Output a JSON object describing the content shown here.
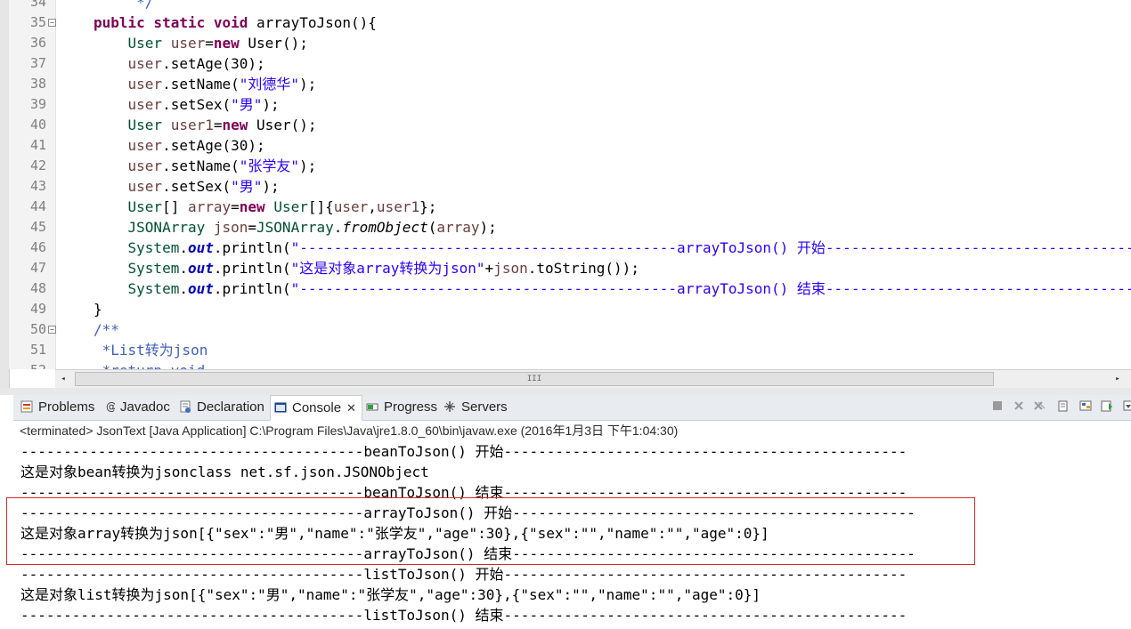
{
  "editor": {
    "lines": [
      {
        "n": "34",
        "fold": false,
        "code": [
          {
            "c": "cmt",
            "t": "     */"
          }
        ]
      },
      {
        "n": "35",
        "fold": true,
        "code": [
          {
            "c": "kw",
            "t": "public static void "
          },
          {
            "c": "",
            "t": "arrayToJson(){"
          }
        ]
      },
      {
        "n": "36",
        "fold": false,
        "code": [
          {
            "c": "",
            "t": "    "
          },
          {
            "c": "ty",
            "t": "User "
          },
          {
            "c": "var",
            "t": "user"
          },
          {
            "c": "",
            "t": "="
          },
          {
            "c": "kw",
            "t": "new "
          },
          {
            "c": "",
            "t": "User();"
          }
        ]
      },
      {
        "n": "37",
        "fold": false,
        "code": [
          {
            "c": "",
            "t": "    "
          },
          {
            "c": "var",
            "t": "user"
          },
          {
            "c": "",
            "t": ".setAge(30);"
          }
        ]
      },
      {
        "n": "38",
        "fold": false,
        "code": [
          {
            "c": "",
            "t": "    "
          },
          {
            "c": "var",
            "t": "user"
          },
          {
            "c": "",
            "t": ".setName("
          },
          {
            "c": "str",
            "t": "\"刘德华\""
          },
          {
            "c": "",
            "t": ");"
          }
        ]
      },
      {
        "n": "39",
        "fold": false,
        "code": [
          {
            "c": "",
            "t": "    "
          },
          {
            "c": "var",
            "t": "user"
          },
          {
            "c": "",
            "t": ".setSex("
          },
          {
            "c": "str",
            "t": "\"男\""
          },
          {
            "c": "",
            "t": ");"
          }
        ]
      },
      {
        "n": "40",
        "fold": false,
        "code": [
          {
            "c": "",
            "t": "    "
          },
          {
            "c": "ty",
            "t": "User "
          },
          {
            "c": "var",
            "t": "user1"
          },
          {
            "c": "",
            "t": "="
          },
          {
            "c": "kw",
            "t": "new "
          },
          {
            "c": "",
            "t": "User();"
          }
        ]
      },
      {
        "n": "41",
        "fold": false,
        "code": [
          {
            "c": "",
            "t": "    "
          },
          {
            "c": "var",
            "t": "user"
          },
          {
            "c": "",
            "t": ".setAge(30);"
          }
        ]
      },
      {
        "n": "42",
        "fold": false,
        "code": [
          {
            "c": "",
            "t": "    "
          },
          {
            "c": "var",
            "t": "user"
          },
          {
            "c": "",
            "t": ".setName("
          },
          {
            "c": "str",
            "t": "\"张学友\""
          },
          {
            "c": "",
            "t": ");"
          }
        ]
      },
      {
        "n": "43",
        "fold": false,
        "code": [
          {
            "c": "",
            "t": "    "
          },
          {
            "c": "var",
            "t": "user"
          },
          {
            "c": "",
            "t": ".setSex("
          },
          {
            "c": "str",
            "t": "\"男\""
          },
          {
            "c": "",
            "t": ");"
          }
        ]
      },
      {
        "n": "44",
        "fold": false,
        "code": [
          {
            "c": "",
            "t": "    "
          },
          {
            "c": "ty",
            "t": "User"
          },
          {
            "c": "",
            "t": "[] "
          },
          {
            "c": "var",
            "t": "array"
          },
          {
            "c": "",
            "t": "="
          },
          {
            "c": "kw",
            "t": "new "
          },
          {
            "c": "ty",
            "t": "User"
          },
          {
            "c": "",
            "t": "[]{"
          },
          {
            "c": "var",
            "t": "user"
          },
          {
            "c": "",
            "t": ","
          },
          {
            "c": "var",
            "t": "user1"
          },
          {
            "c": "",
            "t": "};"
          }
        ]
      },
      {
        "n": "45",
        "fold": false,
        "code": [
          {
            "c": "",
            "t": "    "
          },
          {
            "c": "ty",
            "t": "JSONArray "
          },
          {
            "c": "var",
            "t": "json"
          },
          {
            "c": "",
            "t": "="
          },
          {
            "c": "ty",
            "t": "JSONArray"
          },
          {
            "c": "",
            "t": "."
          },
          {
            "c": "smeth",
            "t": "fromObject"
          },
          {
            "c": "",
            "t": "("
          },
          {
            "c": "var",
            "t": "array"
          },
          {
            "c": "",
            "t": ");"
          }
        ]
      },
      {
        "n": "46",
        "fold": false,
        "code": [
          {
            "c": "",
            "t": "    "
          },
          {
            "c": "ty",
            "t": "System"
          },
          {
            "c": "",
            "t": "."
          },
          {
            "c": "sfield",
            "t": "out"
          },
          {
            "c": "",
            "t": ".println("
          },
          {
            "c": "str",
            "t": "\"--------------------------------------------arrayToJson() 开始-----------------------------------------------\""
          }
        ]
      },
      {
        "n": "47",
        "fold": false,
        "code": [
          {
            "c": "",
            "t": "    "
          },
          {
            "c": "ty",
            "t": "System"
          },
          {
            "c": "",
            "t": "."
          },
          {
            "c": "sfield",
            "t": "out"
          },
          {
            "c": "",
            "t": ".println("
          },
          {
            "c": "str",
            "t": "\"这是对象array转换为json\""
          },
          {
            "c": "",
            "t": "+"
          },
          {
            "c": "var",
            "t": "json"
          },
          {
            "c": "",
            "t": ".toString());"
          }
        ]
      },
      {
        "n": "48",
        "fold": false,
        "code": [
          {
            "c": "",
            "t": "    "
          },
          {
            "c": "ty",
            "t": "System"
          },
          {
            "c": "",
            "t": "."
          },
          {
            "c": "sfield",
            "t": "out"
          },
          {
            "c": "",
            "t": ".println("
          },
          {
            "c": "str",
            "t": "\"--------------------------------------------arrayToJson() 结束-----------------------------------------------\""
          }
        ]
      },
      {
        "n": "49",
        "fold": false,
        "code": [
          {
            "c": "",
            "t": "}"
          }
        ]
      },
      {
        "n": "50",
        "fold": true,
        "code": [
          {
            "c": "cmt",
            "t": "/**"
          }
        ]
      },
      {
        "n": "51",
        "fold": false,
        "code": [
          {
            "c": "cmt",
            "t": " *List转为json"
          }
        ]
      },
      {
        "n": "52",
        "fold": false,
        "code": [
          {
            "c": "cmt",
            "t": " *return void"
          }
        ]
      }
    ]
  },
  "scrollbar": {
    "thumb_glyph": "III",
    "left_arrow": "◂",
    "right_arrow": "▸"
  },
  "tabs": [
    {
      "label": "Problems",
      "icon": "problems-icon",
      "active": false
    },
    {
      "label": "Javadoc",
      "icon": "javadoc-icon",
      "active": false
    },
    {
      "label": "Declaration",
      "icon": "declaration-icon",
      "active": false
    },
    {
      "label": "Console",
      "icon": "console-icon",
      "active": true,
      "close": "✕"
    },
    {
      "label": "Progress",
      "icon": "progress-icon",
      "active": false
    },
    {
      "label": "Servers",
      "icon": "servers-icon",
      "active": false
    }
  ],
  "console": {
    "status": "<terminated> JsonText [Java Application] C:\\Program Files\\Java\\jre1.8.0_60\\bin\\javaw.exe (2016年1月3日 下午1:04:30)",
    "output": [
      "----------------------------------------beanToJson() 开始-----------------------------------------------",
      "这是对象bean转换为jsonclass net.sf.json.JSONObject",
      "----------------------------------------beanToJson() 结束-----------------------------------------------",
      "----------------------------------------arrayToJson() 开始-----------------------------------------------",
      "这是对象array转换为json[{\"sex\":\"男\",\"name\":\"张学友\",\"age\":30},{\"sex\":\"\",\"name\":\"\",\"age\":0}]",
      "----------------------------------------arrayToJson() 结束-----------------------------------------------",
      "----------------------------------------listToJson() 开始-----------------------------------------------",
      "这是对象list转换为json[{\"sex\":\"男\",\"name\":\"张学友\",\"age\":30},{\"sex\":\"\",\"name\":\"\",\"age\":0}]",
      "----------------------------------------listToJson() 结束-----------------------------------------------"
    ]
  },
  "colors": {
    "highlight_box": "#d52a2a",
    "keyword": "#7f0055",
    "string": "#2a00ff",
    "variable": "#6a3e3e"
  }
}
